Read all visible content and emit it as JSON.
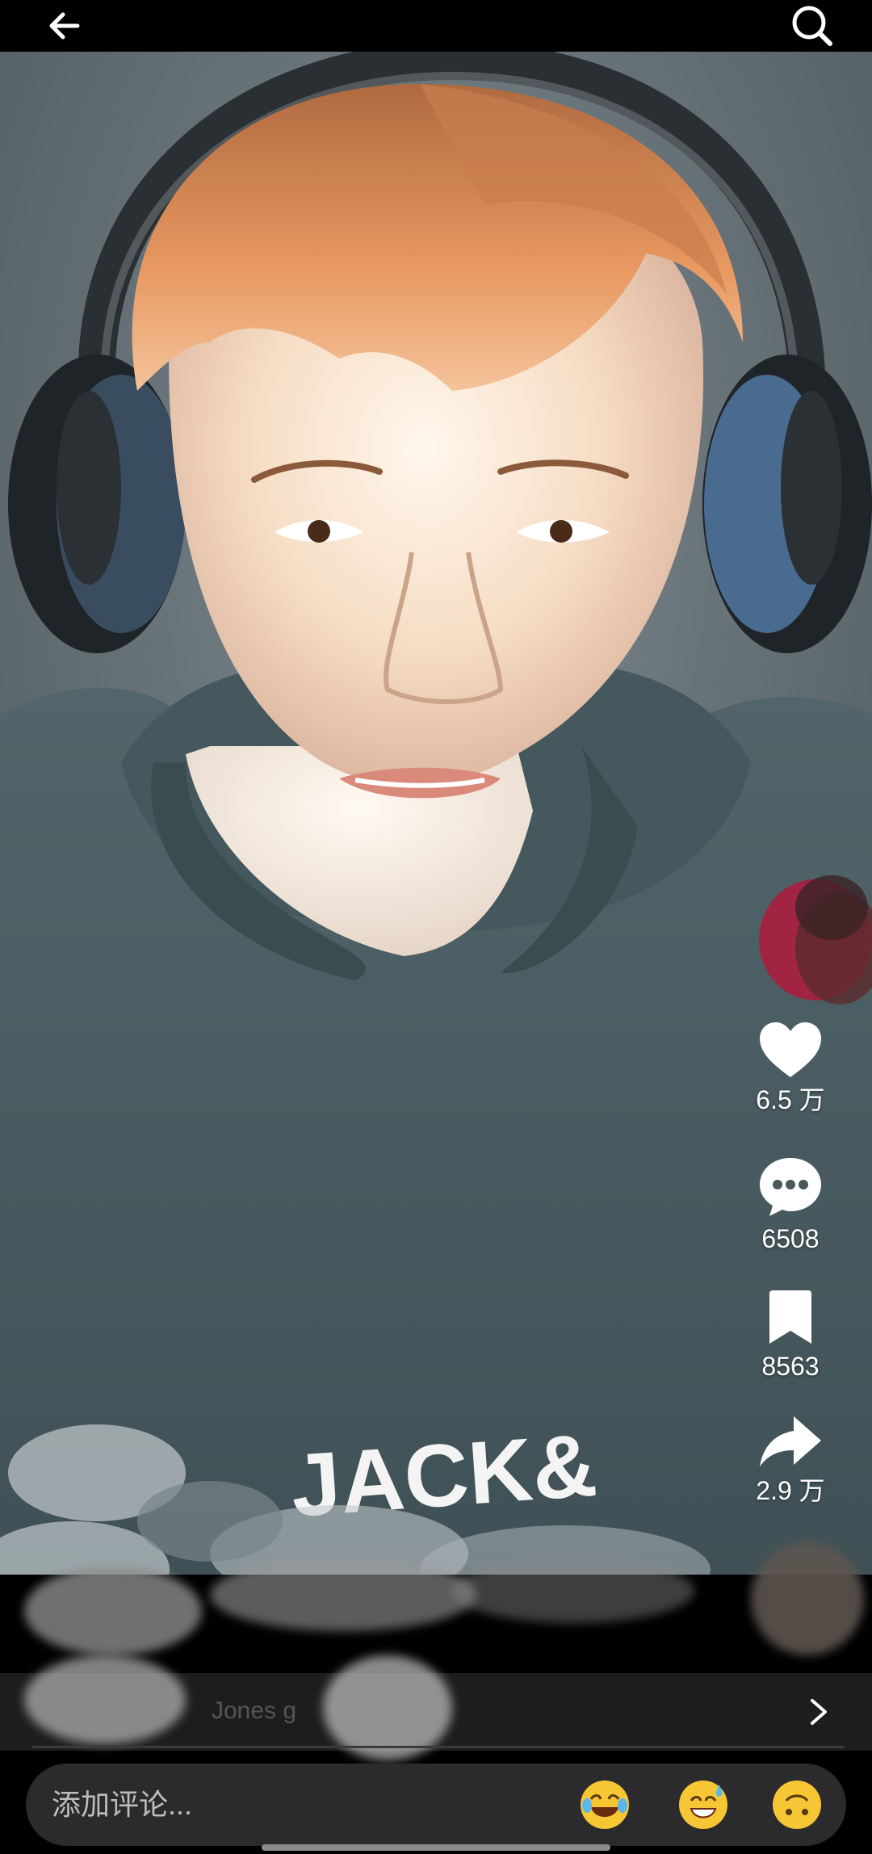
{
  "topbar": {
    "back_icon": "arrow-left-icon",
    "search_icon": "search-icon"
  },
  "actions": {
    "like": {
      "icon": "heart-icon",
      "count": "6.5 万"
    },
    "comment": {
      "icon": "chat-bubble-icon",
      "count": "6508"
    },
    "favorite": {
      "icon": "bookmark-icon",
      "count": "8563"
    },
    "share": {
      "icon": "share-arrow-icon",
      "count": "2.9 万"
    }
  },
  "video": {
    "shirt_text": "JACK&"
  },
  "related": {
    "text": "Jones g",
    "arrow_icon": "chevron-right-icon"
  },
  "comment_bar": {
    "placeholder": "添加评论...",
    "emojis": [
      "😂",
      "😅",
      "🙃"
    ]
  },
  "colors": {
    "background": "#000000",
    "bar": "#2b2b2d",
    "text": "#ffffff"
  }
}
